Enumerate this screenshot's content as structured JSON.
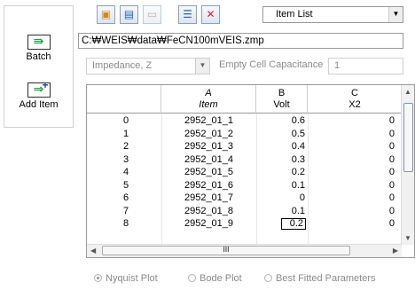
{
  "sidebar": {
    "batch_label": "Batch",
    "add_item_label": "Add Item"
  },
  "toolbar": {
    "buttons": [
      "new-file-icon",
      "open-folder-icon",
      "save-icon",
      "list-view-icon",
      "delete-icon"
    ],
    "item_list_value": "Item List"
  },
  "path": "C:₩WEIS₩data₩FeCN100mVEIS.zmp",
  "impedance_select": "Impedance, Z",
  "empty_cell_label": "Empty Cell Capacitance",
  "empty_cell_value": "1",
  "grid": {
    "columns": [
      {
        "letter": "A",
        "name": "Item"
      },
      {
        "letter": "B",
        "name": "Volt"
      },
      {
        "letter": "C",
        "name": "X2"
      }
    ],
    "rows": [
      {
        "idx": "0",
        "a": "2952_01_1",
        "b": "0.6",
        "c": "0"
      },
      {
        "idx": "1",
        "a": "2952_01_2",
        "b": "0.5",
        "c": "0"
      },
      {
        "idx": "2",
        "a": "2952_01_3",
        "b": "0.4",
        "c": "0"
      },
      {
        "idx": "3",
        "a": "2952_01_4",
        "b": "0.3",
        "c": "0"
      },
      {
        "idx": "4",
        "a": "2952_01_5",
        "b": "0.2",
        "c": "0"
      },
      {
        "idx": "5",
        "a": "2952_01_6",
        "b": "0.1",
        "c": "0"
      },
      {
        "idx": "6",
        "a": "2952_01_7",
        "b": "0",
        "c": "0"
      },
      {
        "idx": "7",
        "a": "2952_01_8",
        "b": "0.1",
        "c": "0"
      },
      {
        "idx": "8",
        "a": "2952_01_9",
        "b": "0.2",
        "c": "0"
      }
    ],
    "hscroll_glyph": "III"
  },
  "plot_options": [
    "Nyquist Plot",
    "Bode Plot",
    "Best Fitted Parameters"
  ]
}
